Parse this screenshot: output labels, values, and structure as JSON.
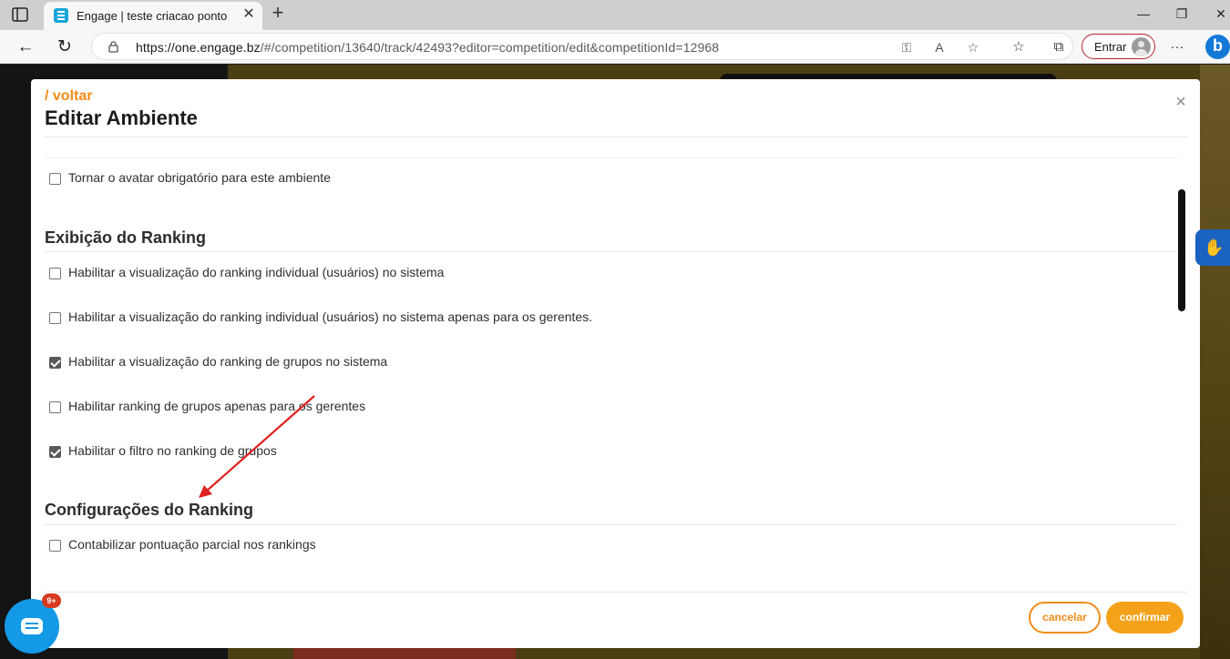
{
  "browser": {
    "tab_title": "Engage | teste criacao ponto",
    "tab_close": "✕",
    "new_tab": "+",
    "url_domain": "https://one.engage.bz",
    "url_path": "/#/competition/13640/track/42493?editor=competition/edit&competitionId=12968",
    "signin_label": "Entrar",
    "window_controls": {
      "minimize": "—",
      "maximize": "❐",
      "close": "✕"
    },
    "nav": {
      "back": "←",
      "refresh": "↻",
      "more": "···"
    }
  },
  "modal": {
    "back_link": "/ voltar",
    "title": "Editar Ambiente",
    "close": "×",
    "options_top": [
      {
        "label": "Tornar o avatar obrigatório para este ambiente",
        "checked": false
      }
    ],
    "ranking_display": {
      "title": "Exibição do Ranking",
      "options": [
        {
          "label": "Habilitar a visualização do ranking individual (usuários) no sistema",
          "checked": false
        },
        {
          "label": "Habilitar a visualização do ranking individual (usuários) no sistema apenas para os gerentes.",
          "checked": false
        },
        {
          "label": "Habilitar a visualização do ranking de grupos no sistema",
          "checked": true
        },
        {
          "label": "Habilitar ranking de grupos apenas para os gerentes",
          "checked": false
        },
        {
          "label": "Habilitar o filtro no ranking de grupos",
          "checked": true
        }
      ]
    },
    "ranking_settings": {
      "title": "Configurações do Ranking",
      "options": [
        {
          "label": "Contabilizar pontuação parcial nos rankings",
          "checked": false
        }
      ]
    },
    "buttons": {
      "cancel": "cancelar",
      "confirm": "confirmar"
    }
  },
  "chat": {
    "badge": "9+"
  },
  "colors": {
    "accent": "#f28c18",
    "confirm": "#f5a21b",
    "annotation_arrow": "#e02020"
  }
}
